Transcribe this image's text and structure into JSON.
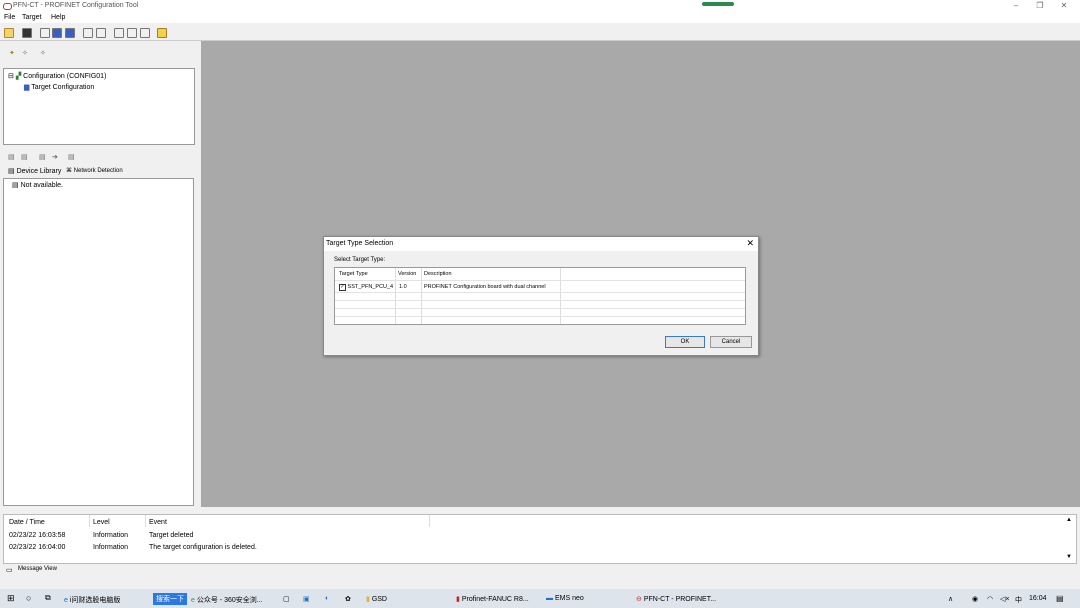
{
  "window": {
    "title": "PFN-CT - PROFINET Configuration Tool",
    "menu": [
      "File",
      "Target",
      "Help"
    ]
  },
  "tree": {
    "root": "Configuration (CONFIG01)",
    "child": "Target Configuration"
  },
  "library": {
    "tabs": [
      "Device Library",
      "Network Detection"
    ],
    "item": "Not available."
  },
  "dialog": {
    "title": "Target Type Selection",
    "close": "✕",
    "group_label": "Select Target Type:",
    "columns": [
      "Target Type",
      "Version",
      "Description"
    ],
    "rows": [
      {
        "checked": true,
        "type": "SST_PFN_PCU_4",
        "version": "1.0",
        "description": "PROFINET Configuration board with dual channel"
      }
    ],
    "ok": "OK",
    "cancel": "Cancel"
  },
  "log": {
    "columns": [
      "Date / Time",
      "Level",
      "Event"
    ],
    "rows": [
      {
        "time": "02/23/22 16:03:58",
        "level": "Information",
        "event": "Target deleted"
      },
      {
        "time": "02/23/22 16:04:00",
        "level": "Information",
        "event": "The target configuration is deleted."
      }
    ],
    "tab_label": "Message View"
  },
  "taskbar": {
    "search_button": "搜索一下",
    "items": [
      "i问财选股电脑版",
      "公众号 - 360安全浏...",
      "GSD",
      "Profinet-FANUC R8...",
      "EMS neo",
      "PFN-CT - PROFINET..."
    ],
    "clock": "16:04",
    "ime": "中"
  },
  "colors": {
    "workspace": "#a9a9a9",
    "taskbar": "#dde4ec"
  }
}
